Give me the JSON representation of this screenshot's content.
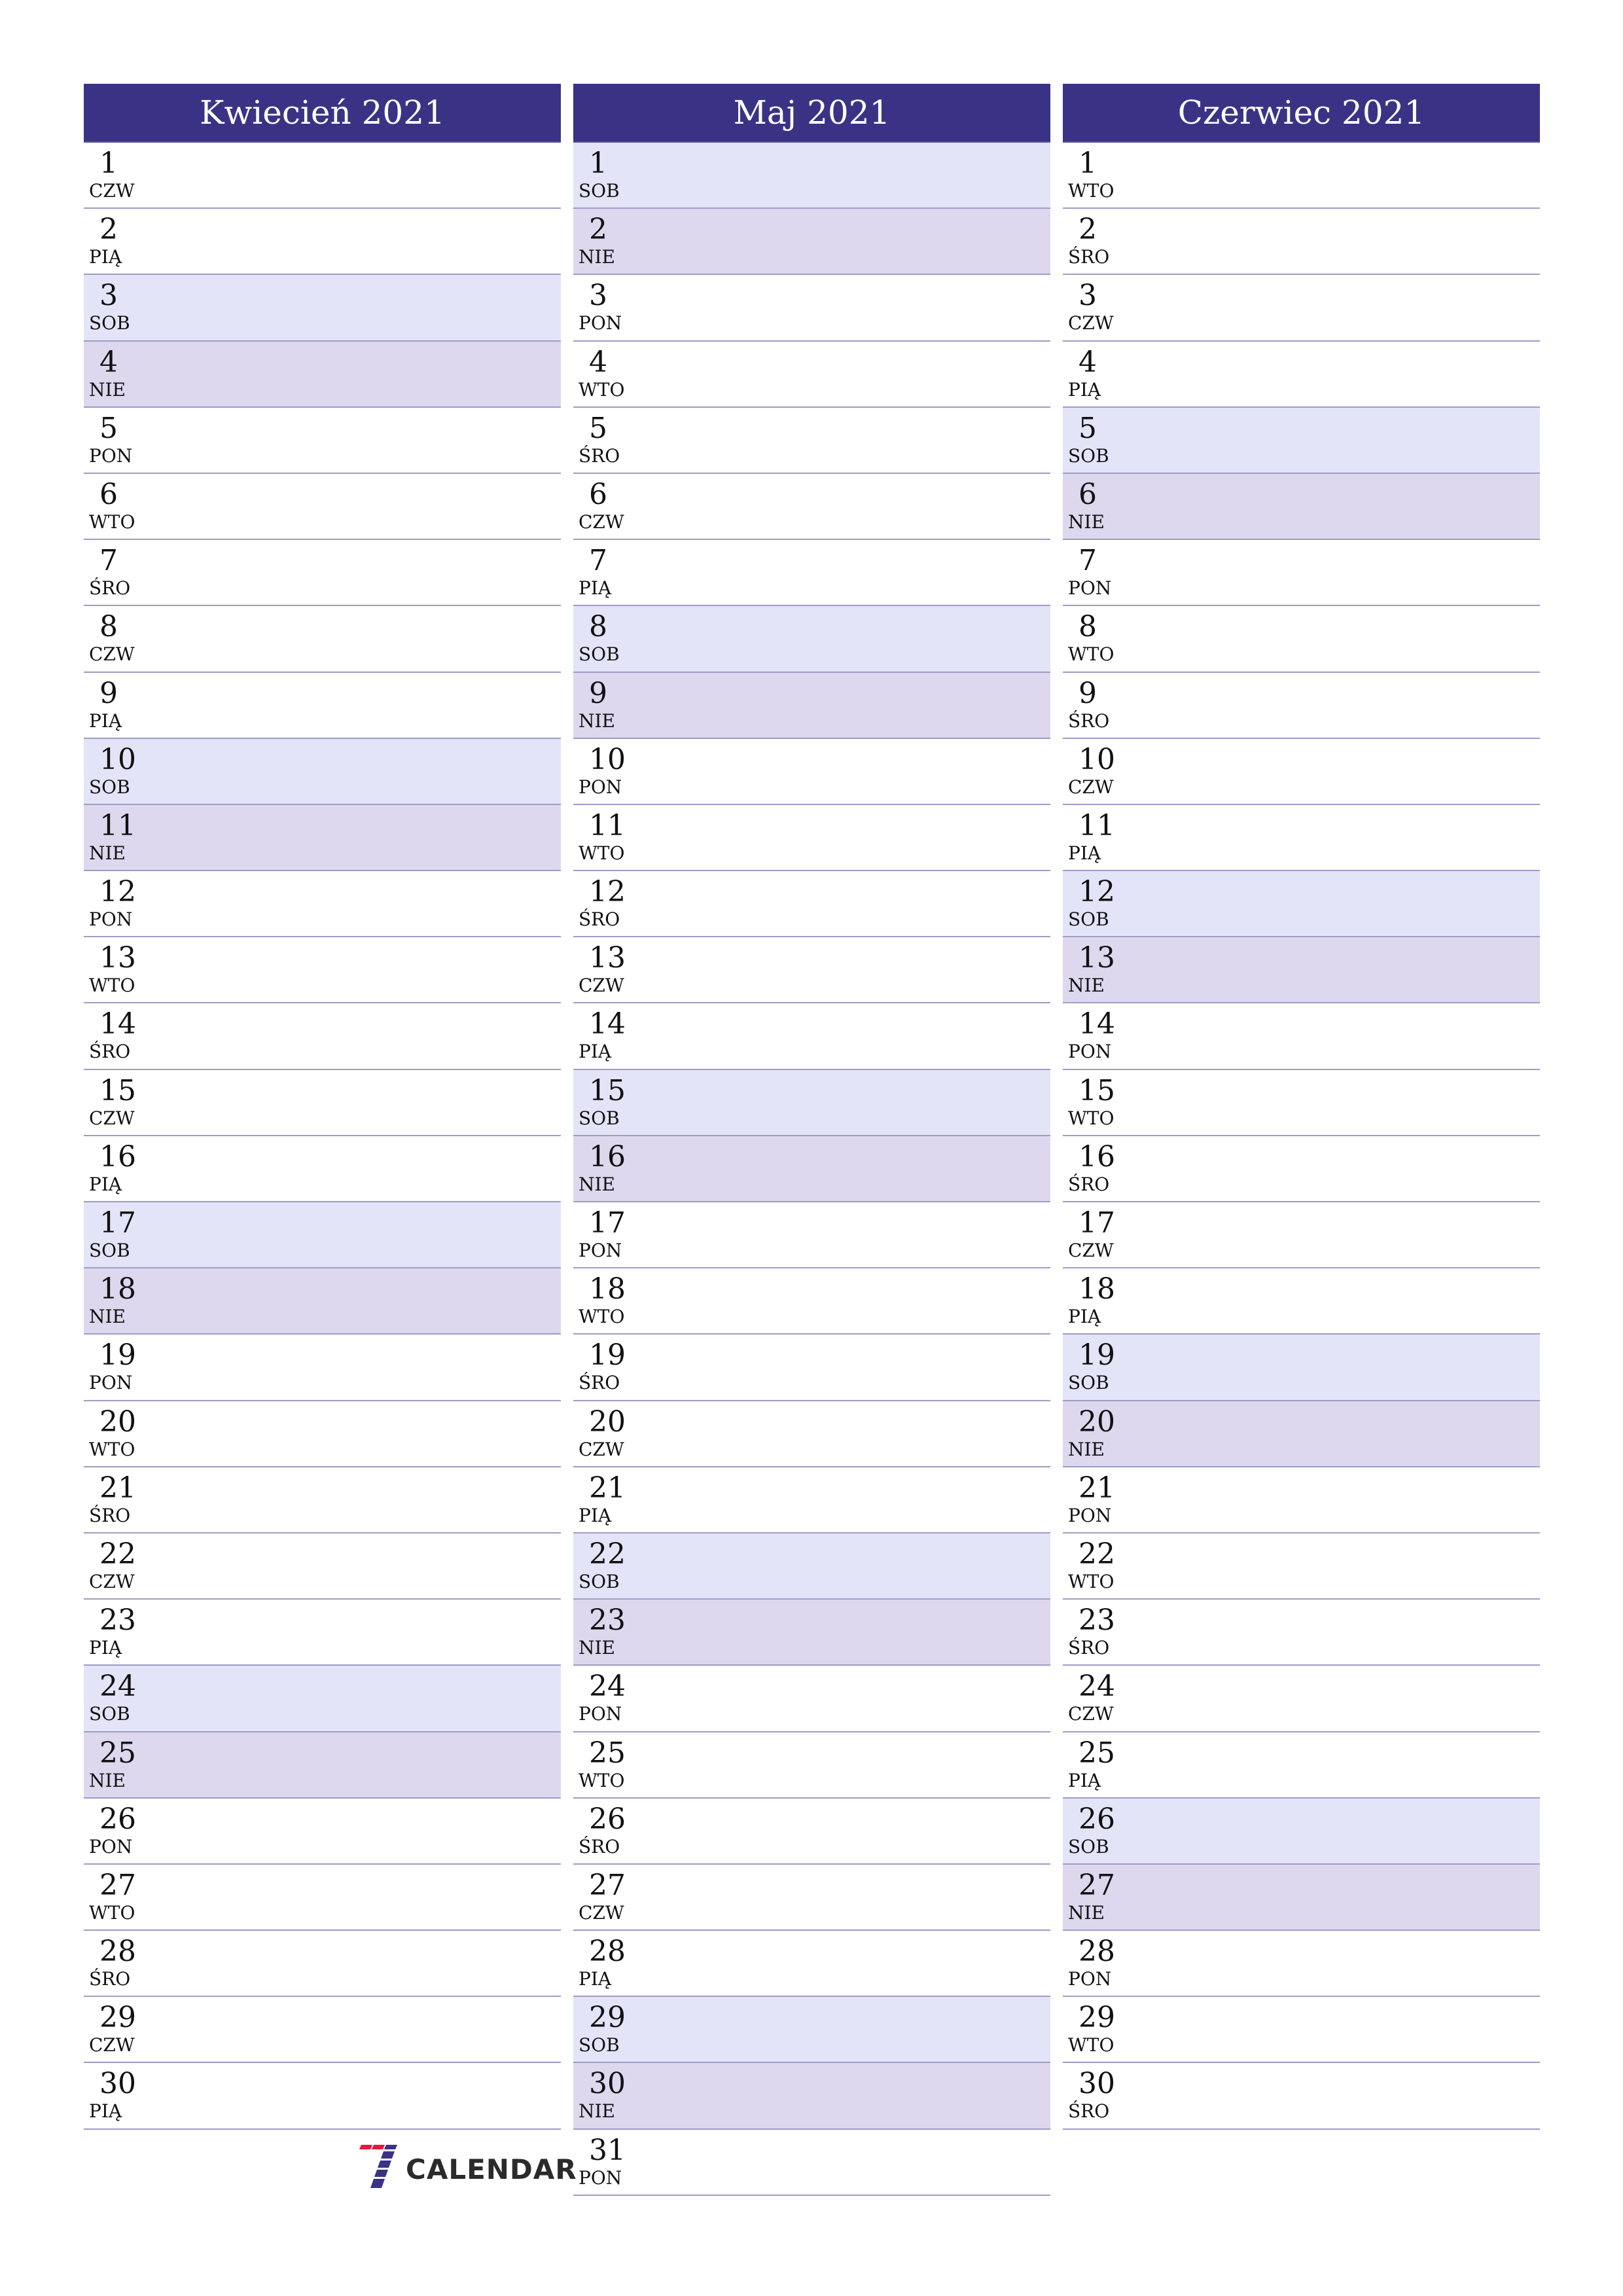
{
  "months": [
    {
      "title": "Kwiecień 2021",
      "days": [
        {
          "n": "1",
          "d": "CZW",
          "t": ""
        },
        {
          "n": "2",
          "d": "PIĄ",
          "t": ""
        },
        {
          "n": "3",
          "d": "SOB",
          "t": "sat"
        },
        {
          "n": "4",
          "d": "NIE",
          "t": "sun"
        },
        {
          "n": "5",
          "d": "PON",
          "t": ""
        },
        {
          "n": "6",
          "d": "WTO",
          "t": ""
        },
        {
          "n": "7",
          "d": "ŚRO",
          "t": ""
        },
        {
          "n": "8",
          "d": "CZW",
          "t": ""
        },
        {
          "n": "9",
          "d": "PIĄ",
          "t": ""
        },
        {
          "n": "10",
          "d": "SOB",
          "t": "sat"
        },
        {
          "n": "11",
          "d": "NIE",
          "t": "sun"
        },
        {
          "n": "12",
          "d": "PON",
          "t": ""
        },
        {
          "n": "13",
          "d": "WTO",
          "t": ""
        },
        {
          "n": "14",
          "d": "ŚRO",
          "t": ""
        },
        {
          "n": "15",
          "d": "CZW",
          "t": ""
        },
        {
          "n": "16",
          "d": "PIĄ",
          "t": ""
        },
        {
          "n": "17",
          "d": "SOB",
          "t": "sat"
        },
        {
          "n": "18",
          "d": "NIE",
          "t": "sun"
        },
        {
          "n": "19",
          "d": "PON",
          "t": ""
        },
        {
          "n": "20",
          "d": "WTO",
          "t": ""
        },
        {
          "n": "21",
          "d": "ŚRO",
          "t": ""
        },
        {
          "n": "22",
          "d": "CZW",
          "t": ""
        },
        {
          "n": "23",
          "d": "PIĄ",
          "t": ""
        },
        {
          "n": "24",
          "d": "SOB",
          "t": "sat"
        },
        {
          "n": "25",
          "d": "NIE",
          "t": "sun"
        },
        {
          "n": "26",
          "d": "PON",
          "t": ""
        },
        {
          "n": "27",
          "d": "WTO",
          "t": ""
        },
        {
          "n": "28",
          "d": "ŚRO",
          "t": ""
        },
        {
          "n": "29",
          "d": "CZW",
          "t": ""
        },
        {
          "n": "30",
          "d": "PIĄ",
          "t": ""
        }
      ]
    },
    {
      "title": "Maj 2021",
      "days": [
        {
          "n": "1",
          "d": "SOB",
          "t": "sat"
        },
        {
          "n": "2",
          "d": "NIE",
          "t": "sun"
        },
        {
          "n": "3",
          "d": "PON",
          "t": ""
        },
        {
          "n": "4",
          "d": "WTO",
          "t": ""
        },
        {
          "n": "5",
          "d": "ŚRO",
          "t": ""
        },
        {
          "n": "6",
          "d": "CZW",
          "t": ""
        },
        {
          "n": "7",
          "d": "PIĄ",
          "t": ""
        },
        {
          "n": "8",
          "d": "SOB",
          "t": "sat"
        },
        {
          "n": "9",
          "d": "NIE",
          "t": "sun"
        },
        {
          "n": "10",
          "d": "PON",
          "t": ""
        },
        {
          "n": "11",
          "d": "WTO",
          "t": ""
        },
        {
          "n": "12",
          "d": "ŚRO",
          "t": ""
        },
        {
          "n": "13",
          "d": "CZW",
          "t": ""
        },
        {
          "n": "14",
          "d": "PIĄ",
          "t": ""
        },
        {
          "n": "15",
          "d": "SOB",
          "t": "sat"
        },
        {
          "n": "16",
          "d": "NIE",
          "t": "sun"
        },
        {
          "n": "17",
          "d": "PON",
          "t": ""
        },
        {
          "n": "18",
          "d": "WTO",
          "t": ""
        },
        {
          "n": "19",
          "d": "ŚRO",
          "t": ""
        },
        {
          "n": "20",
          "d": "CZW",
          "t": ""
        },
        {
          "n": "21",
          "d": "PIĄ",
          "t": ""
        },
        {
          "n": "22",
          "d": "SOB",
          "t": "sat"
        },
        {
          "n": "23",
          "d": "NIE",
          "t": "sun"
        },
        {
          "n": "24",
          "d": "PON",
          "t": ""
        },
        {
          "n": "25",
          "d": "WTO",
          "t": ""
        },
        {
          "n": "26",
          "d": "ŚRO",
          "t": ""
        },
        {
          "n": "27",
          "d": "CZW",
          "t": ""
        },
        {
          "n": "28",
          "d": "PIĄ",
          "t": ""
        },
        {
          "n": "29",
          "d": "SOB",
          "t": "sat"
        },
        {
          "n": "30",
          "d": "NIE",
          "t": "sun"
        },
        {
          "n": "31",
          "d": "PON",
          "t": ""
        }
      ]
    },
    {
      "title": "Czerwiec 2021",
      "days": [
        {
          "n": "1",
          "d": "WTO",
          "t": ""
        },
        {
          "n": "2",
          "d": "ŚRO",
          "t": ""
        },
        {
          "n": "3",
          "d": "CZW",
          "t": ""
        },
        {
          "n": "4",
          "d": "PIĄ",
          "t": ""
        },
        {
          "n": "5",
          "d": "SOB",
          "t": "sat"
        },
        {
          "n": "6",
          "d": "NIE",
          "t": "sun"
        },
        {
          "n": "7",
          "d": "PON",
          "t": ""
        },
        {
          "n": "8",
          "d": "WTO",
          "t": ""
        },
        {
          "n": "9",
          "d": "ŚRO",
          "t": ""
        },
        {
          "n": "10",
          "d": "CZW",
          "t": ""
        },
        {
          "n": "11",
          "d": "PIĄ",
          "t": ""
        },
        {
          "n": "12",
          "d": "SOB",
          "t": "sat"
        },
        {
          "n": "13",
          "d": "NIE",
          "t": "sun"
        },
        {
          "n": "14",
          "d": "PON",
          "t": ""
        },
        {
          "n": "15",
          "d": "WTO",
          "t": ""
        },
        {
          "n": "16",
          "d": "ŚRO",
          "t": ""
        },
        {
          "n": "17",
          "d": "CZW",
          "t": ""
        },
        {
          "n": "18",
          "d": "PIĄ",
          "t": ""
        },
        {
          "n": "19",
          "d": "SOB",
          "t": "sat"
        },
        {
          "n": "20",
          "d": "NIE",
          "t": "sun"
        },
        {
          "n": "21",
          "d": "PON",
          "t": ""
        },
        {
          "n": "22",
          "d": "WTO",
          "t": ""
        },
        {
          "n": "23",
          "d": "ŚRO",
          "t": ""
        },
        {
          "n": "24",
          "d": "CZW",
          "t": ""
        },
        {
          "n": "25",
          "d": "PIĄ",
          "t": ""
        },
        {
          "n": "26",
          "d": "SOB",
          "t": "sat"
        },
        {
          "n": "27",
          "d": "NIE",
          "t": "sun"
        },
        {
          "n": "28",
          "d": "PON",
          "t": ""
        },
        {
          "n": "29",
          "d": "WTO",
          "t": ""
        },
        {
          "n": "30",
          "d": "ŚRO",
          "t": ""
        }
      ]
    }
  ],
  "logo": {
    "text": "CALENDAR",
    "icon": "seven-logo-icon",
    "colors": {
      "top": "#E8173F",
      "stem": "#3A3385"
    }
  },
  "colors": {
    "header": "#3A3385",
    "saturday": "#E4E4F8",
    "sunday": "#DDD8EE",
    "divider": "#9E9CC6"
  }
}
